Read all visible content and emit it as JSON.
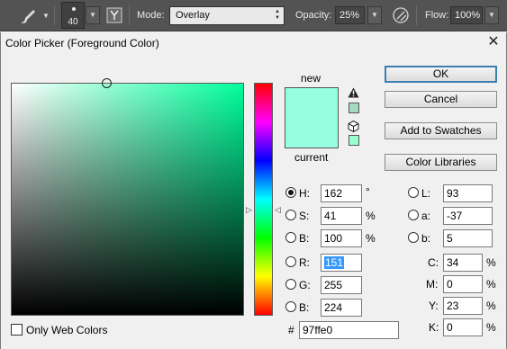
{
  "toolbar": {
    "brush_size": "40",
    "mode_label": "Mode:",
    "mode_value": "Overlay",
    "opacity_label": "Opacity:",
    "opacity_value": "25%",
    "flow_label": "Flow:",
    "flow_value": "100%"
  },
  "dialog": {
    "title": "Color Picker (Foreground Color)",
    "buttons": {
      "ok": "OK",
      "cancel": "Cancel",
      "add_to_swatches": "Add to Swatches",
      "color_libraries": "Color Libraries"
    },
    "swatches": {
      "new_label": "new",
      "current_label": "current",
      "new_color": "#97ffe0",
      "current_color": "#97ffe0",
      "gamut_swatch_color": "#a6d9c4",
      "web_swatch_color": "#99ffcc"
    },
    "hsb": {
      "h_label": "H:",
      "h_value": "162",
      "h_unit": "°",
      "s_label": "S:",
      "s_value": "41",
      "s_unit": "%",
      "b_label": "B:",
      "b_value": "100",
      "b_unit": "%",
      "selected": "H"
    },
    "rgb": {
      "r_label": "R:",
      "r_value": "151",
      "g_label": "G:",
      "g_value": "255",
      "b_label": "B:",
      "b_value": "224"
    },
    "lab": {
      "l_label": "L:",
      "l_value": "93",
      "a_label": "a:",
      "a_value": "-37",
      "b_label": "b:",
      "b_value": "5"
    },
    "cmyk": {
      "c_label": "C:",
      "c_value": "34",
      "m_label": "M:",
      "m_value": "0",
      "y_label": "Y:",
      "y_value": "23",
      "k_label": "K:",
      "k_value": "0",
      "unit": "%"
    },
    "hex": {
      "label": "#",
      "value": "97ffe0"
    },
    "only_web_colors": {
      "label": "Only Web Colors",
      "checked": false
    },
    "hue_slider_fraction": 0.55,
    "picker_saturation": 0.41,
    "picker_brightness": 1.0
  }
}
